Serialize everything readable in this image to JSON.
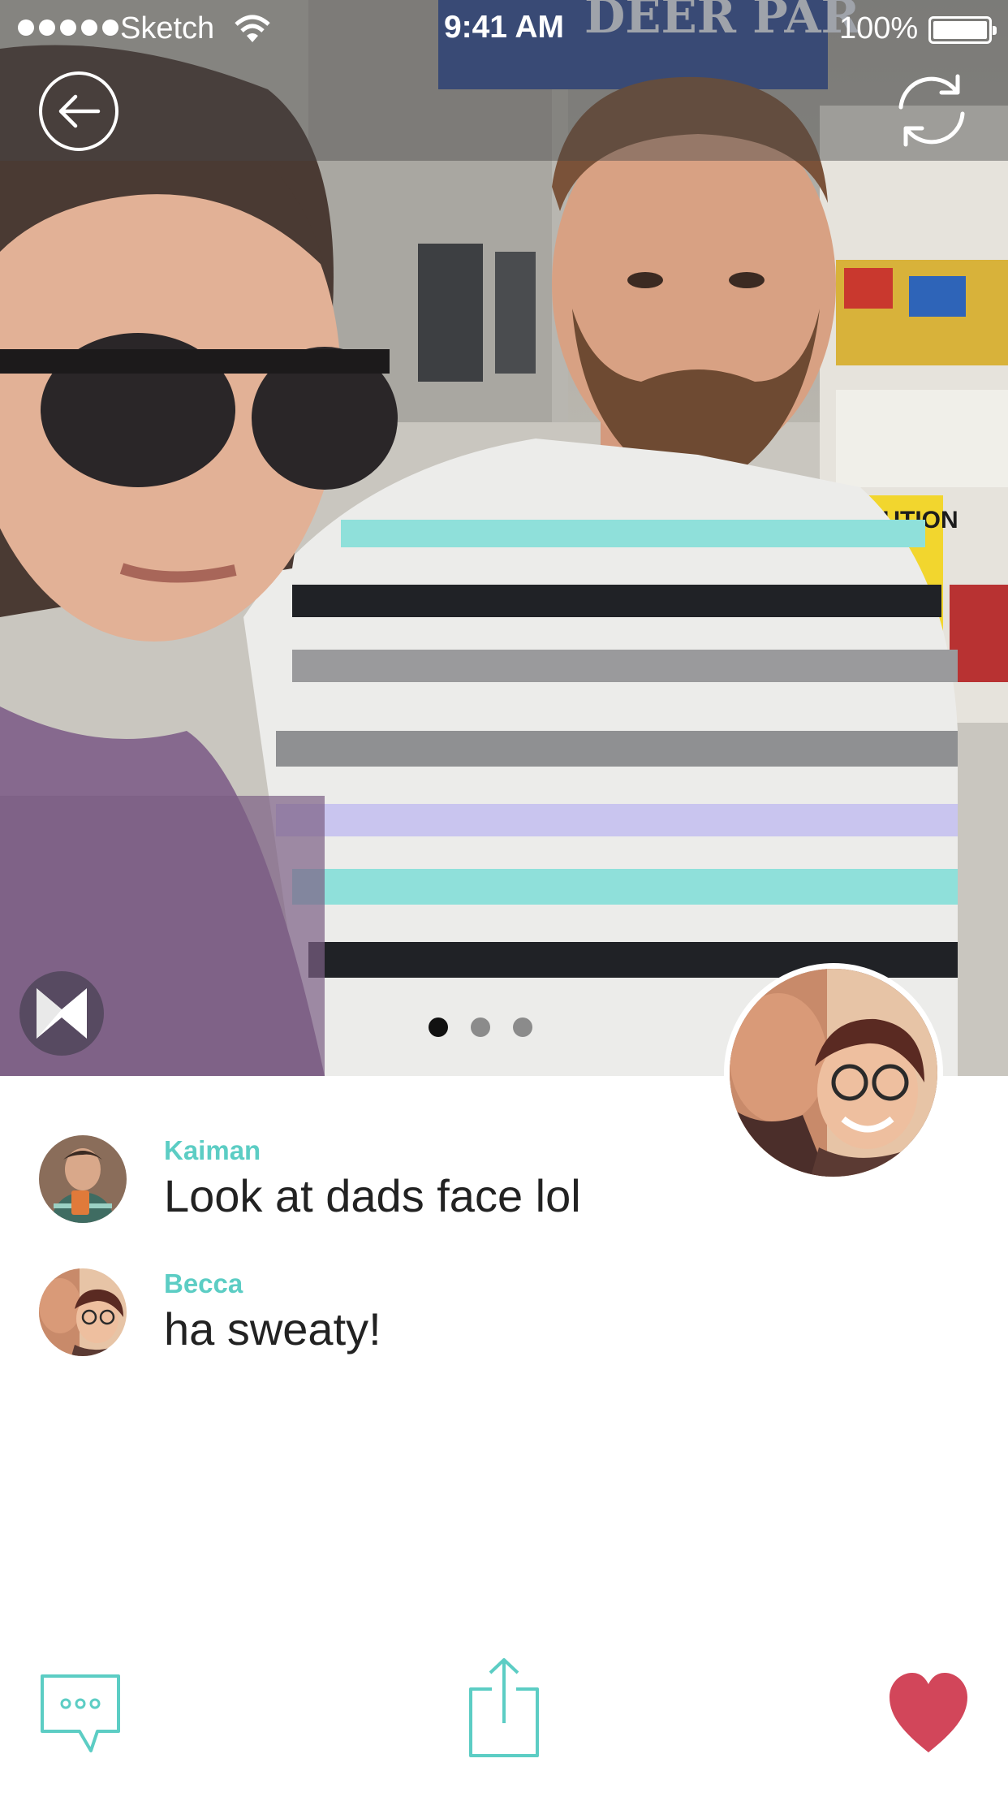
{
  "status_bar": {
    "carrier": "Sketch",
    "time": "9:41 AM",
    "battery": "100%"
  },
  "photo": {
    "sign_text": "DEER PAR",
    "caution_text": "CAUTION",
    "page_count": 3,
    "active_page": 1
  },
  "comments": [
    {
      "author": "Kaiman",
      "text": "Look at dads face lol"
    },
    {
      "author": "Becca",
      "text": "ha sweaty!"
    }
  ],
  "colors": {
    "accent": "#5ccdc4",
    "like": "#d2465a",
    "text": "#222222"
  },
  "icons": {
    "back": "arrow-left-icon",
    "refresh": "refresh-icon",
    "chat": "chat-bubble-icon",
    "share": "share-icon",
    "like": "heart-icon",
    "brand": "hourglass-logo-icon"
  }
}
